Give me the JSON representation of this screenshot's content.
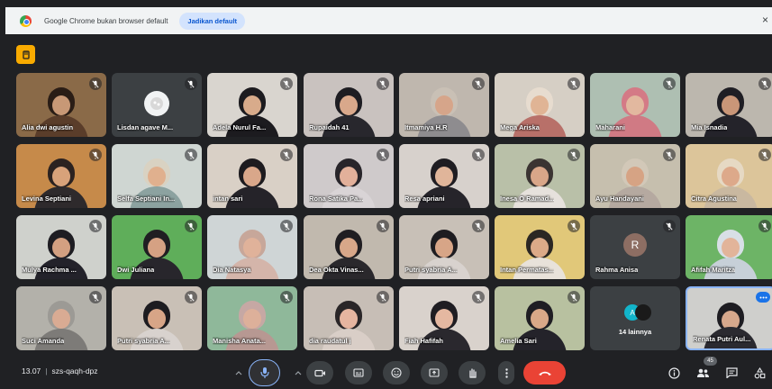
{
  "infobar": {
    "message": "Google Chrome bukan browser default",
    "button_label": "Jadikan default",
    "close_label": "×"
  },
  "participants": [
    {
      "name": "Alia dwi agustin",
      "bg": "#8a6a48",
      "hair": "#2a1d16",
      "skin": "#c89876",
      "shirt": "#5a3d2a"
    },
    {
      "name": "Lisdan agave M...",
      "avatar": true,
      "bg": "#3c4043",
      "avatar_color": "#f1f3f4"
    },
    {
      "name": "Adela Nurul Fa...",
      "bg": "#d9d5cf",
      "hair": "#1c1b1f",
      "skin": "#d8ab8b",
      "shirt": "#1c1b1f"
    },
    {
      "name": "Rupaidah 41",
      "bg": "#c9c2bf",
      "hair": "#1e1d22",
      "skin": "#d9a88b",
      "shirt": "#28272d"
    },
    {
      "name": "Itmamiya H.R",
      "bg": "#bfb7ae",
      "hair": "#c9c0b5",
      "skin": "#d6a58a",
      "shirt": "#8e8c8f"
    },
    {
      "name": "Mega Ariska",
      "bg": "#d6cfc5",
      "hair": "#e7dccf",
      "skin": "#e0b495",
      "shirt": "#b87069"
    },
    {
      "name": "Maharani",
      "bg": "#aebfb2",
      "hair": "#d47a86",
      "skin": "#e2b89f",
      "shirt": "#d07a84"
    },
    {
      "name": "Mia Isnadia",
      "bg": "#bcb7ae",
      "hair": "#1f1e24",
      "skin": "#c99678",
      "shirt": "#24232a"
    },
    {
      "name": "Levina Septiani",
      "bg": "#c68a4a",
      "hair": "#2b2220",
      "skin": "#d8a27a",
      "shirt": "#2e2a2c"
    },
    {
      "name": "Selfa Septiani In...",
      "bg": "#cfd6d2",
      "hair": "#d9d2c2",
      "skin": "#e0b08e",
      "shirt": "#8ca2a0"
    },
    {
      "name": "intan sari",
      "bg": "#d9d0c6",
      "hair": "#1d1b1f",
      "skin": "#d9a78a",
      "shirt": "#252329"
    },
    {
      "name": "Rona Satika Pa...",
      "bg": "#cfcacb",
      "hair": "#28252a",
      "skin": "#e2b09a",
      "shirt": "#d9d4d6"
    },
    {
      "name": "Resa apriani",
      "bg": "#d7d1cc",
      "hair": "#1f1d22",
      "skin": "#e0b59a",
      "shirt": "#26242a"
    },
    {
      "name": "Inesa O Ramad...",
      "bg": "#b9c0a8",
      "hair": "#3b3432",
      "skin": "#d9a689",
      "shirt": "#e6e1dc"
    },
    {
      "name": "Ayu Handayani",
      "bg": "#c6bfae",
      "hair": "#d2c8b8",
      "skin": "#d6a384",
      "shirt": "#b5a9a0"
    },
    {
      "name": "Citra Agustina",
      "bg": "#dcc59a",
      "hair": "#e6d9c4",
      "skin": "#dda98a",
      "shirt": "#c9b8a0"
    },
    {
      "name": "Mulya Rachma ...",
      "bg": "#cfd1cc",
      "hair": "#1e1d22",
      "skin": "#d3a081",
      "shirt": "#23222a"
    },
    {
      "name": "Dwi Juliana",
      "bg": "#5fae5a",
      "hair": "#1f1e22",
      "skin": "#d5a183",
      "shirt": "#28262c"
    },
    {
      "name": "Dia Natasya",
      "bg": "#cfd5d6",
      "hair": "#c7a79a",
      "skin": "#e0b29a",
      "shirt": "#d4b5aa"
    },
    {
      "name": "Dea Okta Vinas...",
      "bg": "#c1b9ae",
      "hair": "#201e22",
      "skin": "#d8a789",
      "shirt": "#2a282c"
    },
    {
      "name": "Putri syabria A...",
      "bg": "#c8c0b7",
      "hair": "#1d1c20",
      "skin": "#d7a587",
      "shirt": "#d8d2ce"
    },
    {
      "name": "Intan Permatas...",
      "bg": "#e1c879",
      "hair": "#2b2723",
      "skin": "#dcaa88",
      "shirt": "#e8e2da"
    },
    {
      "name": "Rahma Anisa",
      "avatar": true,
      "letter": "R",
      "bg": "#3c4043",
      "avatar_color": "#8d6e63"
    },
    {
      "name": "Afifah Maritza",
      "bg": "#6db466",
      "hair": "#d8dfe6",
      "skin": "#e2b49a",
      "shirt": "#c7d0d8"
    },
    {
      "name": "Suci Amanda",
      "bg": "#b3b1aa",
      "hair": "#9c9a95",
      "skin": "#d9ab93",
      "shirt": "#7d7b78"
    },
    {
      "name": "Putri syabria A...",
      "bg": "#c9c0b6",
      "hair": "#1d1c20",
      "skin": "#d7a587",
      "shirt": "#d8d2ce"
    },
    {
      "name": "Manisha Anata...",
      "bg": "#8fb89a",
      "hair": "#c6a8a4",
      "skin": "#ddb09a",
      "shirt": "#b79892"
    },
    {
      "name": "dia raudatul j",
      "bg": "#c7beb6",
      "hair": "#2a2628",
      "skin": "#e6b5a0",
      "shirt": "#d9cec7"
    },
    {
      "name": "Fiah Hafifah",
      "bg": "#d9d2cc",
      "hair": "#1f1d22",
      "skin": "#e5b8a1",
      "shirt": "#2a282e"
    },
    {
      "name": "Amelia Sari",
      "bg": "#b8c1a0",
      "hair": "#1f1e23",
      "skin": "#d9a888",
      "shirt": "#24232a"
    },
    {
      "name": "14 lainnya",
      "others": true,
      "bg": "#3c4043",
      "letter": "A"
    },
    {
      "name": "Renata Putri Aul...",
      "active": true,
      "bg": "#cfcfcc",
      "hair": "#1e1d22",
      "skin": "#d7a88c",
      "shirt": "#2b2a30"
    }
  ],
  "meeting": {
    "time": "13.07",
    "separator": "|",
    "code": "szs-qaqh-dpz"
  },
  "participant_count": "45",
  "colors": {
    "end_call": "#ea4335",
    "hand_raise": "#f9ab00",
    "active_speaker": "#8ab4f8",
    "mic_ring": "#8ab4f8"
  },
  "icons": {
    "mic": "mic-icon",
    "camera": "camera-icon",
    "captions": "captions-icon",
    "emoji": "emoji-icon",
    "present": "present-icon",
    "hand": "hand-icon",
    "more": "more-icon",
    "end_call": "end-call-icon",
    "info": "info-icon",
    "people": "people-icon",
    "chat": "chat-icon",
    "activities": "activities-icon"
  }
}
